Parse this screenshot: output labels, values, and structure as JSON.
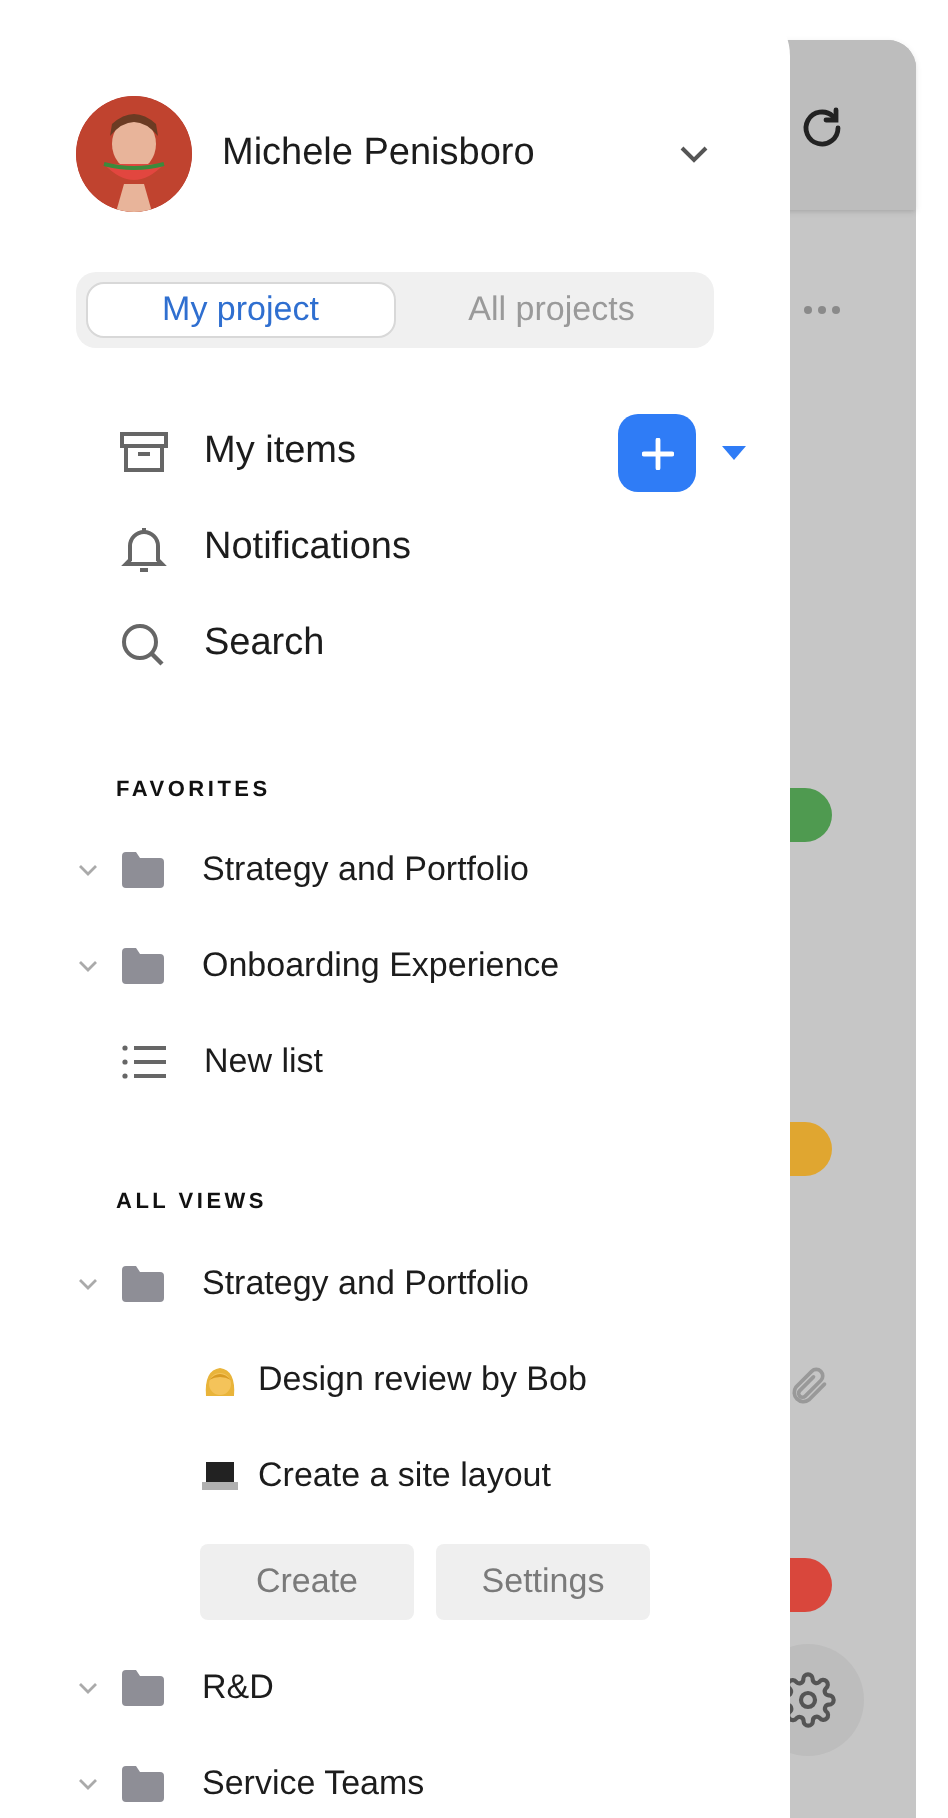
{
  "user": {
    "name": "Michele Penisboro"
  },
  "tabs": [
    {
      "label": "My project",
      "selected": true
    },
    {
      "label": "All projects",
      "selected": false
    }
  ],
  "nav": [
    {
      "label": "My items",
      "kind": "archive",
      "add_button": true
    },
    {
      "label": "Notifications",
      "kind": "bell",
      "add_button": false
    },
    {
      "label": "Search",
      "kind": "search",
      "add_button": false
    }
  ],
  "sections": [
    {
      "title": "FAVORITES",
      "items": [
        {
          "label": "Strategy and Portfolio",
          "kind": "folder"
        },
        {
          "label": "Onboarding Experience",
          "kind": "folder"
        },
        {
          "label": "New list",
          "kind": "list"
        }
      ]
    },
    {
      "title": "ALL VIEWS",
      "items": [
        {
          "label": "Strategy and Portfolio",
          "kind": "folder",
          "children": [
            {
              "label": "Design review by Bob",
              "kind": "face"
            },
            {
              "label": "Create a site layout",
              "kind": "laptop"
            }
          ],
          "actions": [
            "Create",
            "Settings"
          ]
        },
        {
          "label": "R&D",
          "kind": "folder"
        },
        {
          "label": "Service Teams",
          "kind": "folder"
        }
      ]
    }
  ],
  "background": {
    "status_dots": [
      {
        "color": "#4f9a50"
      },
      {
        "color": "#e0a630"
      },
      {
        "color": "#d9473c"
      }
    ]
  }
}
